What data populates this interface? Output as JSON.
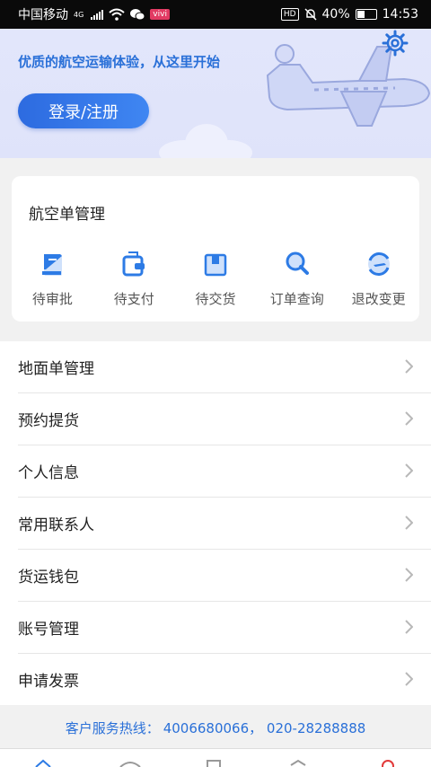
{
  "status_bar": {
    "carrier": "中国移动",
    "network": "4G",
    "battery": "40%",
    "time": "14:53",
    "hd": "HD"
  },
  "hero": {
    "slogan": "优质的航空运输体验，从这里开始",
    "login_label": "登录/注册"
  },
  "air_waybill": {
    "title": "航空单管理",
    "items": [
      {
        "label": "待审批",
        "icon": "document-approval-icon"
      },
      {
        "label": "待支付",
        "icon": "wallet-icon"
      },
      {
        "label": "待交货",
        "icon": "package-icon"
      },
      {
        "label": "订单查询",
        "icon": "search-icon"
      },
      {
        "label": "退改变更",
        "icon": "plane-change-icon"
      }
    ]
  },
  "menu": [
    {
      "label": "地面单管理"
    },
    {
      "label": "预约提货"
    },
    {
      "label": "个人信息"
    },
    {
      "label": "常用联系人"
    },
    {
      "label": "货运钱包"
    },
    {
      "label": "账号管理"
    },
    {
      "label": "申请发票"
    }
  ],
  "hotline": {
    "label": "客户服务热线：",
    "numbers": "4006680066，  020-28288888"
  },
  "colors": {
    "accent": "#2a70d8",
    "hero_bg": "#e2e6fb",
    "icon_blue": "#2d7be5"
  }
}
